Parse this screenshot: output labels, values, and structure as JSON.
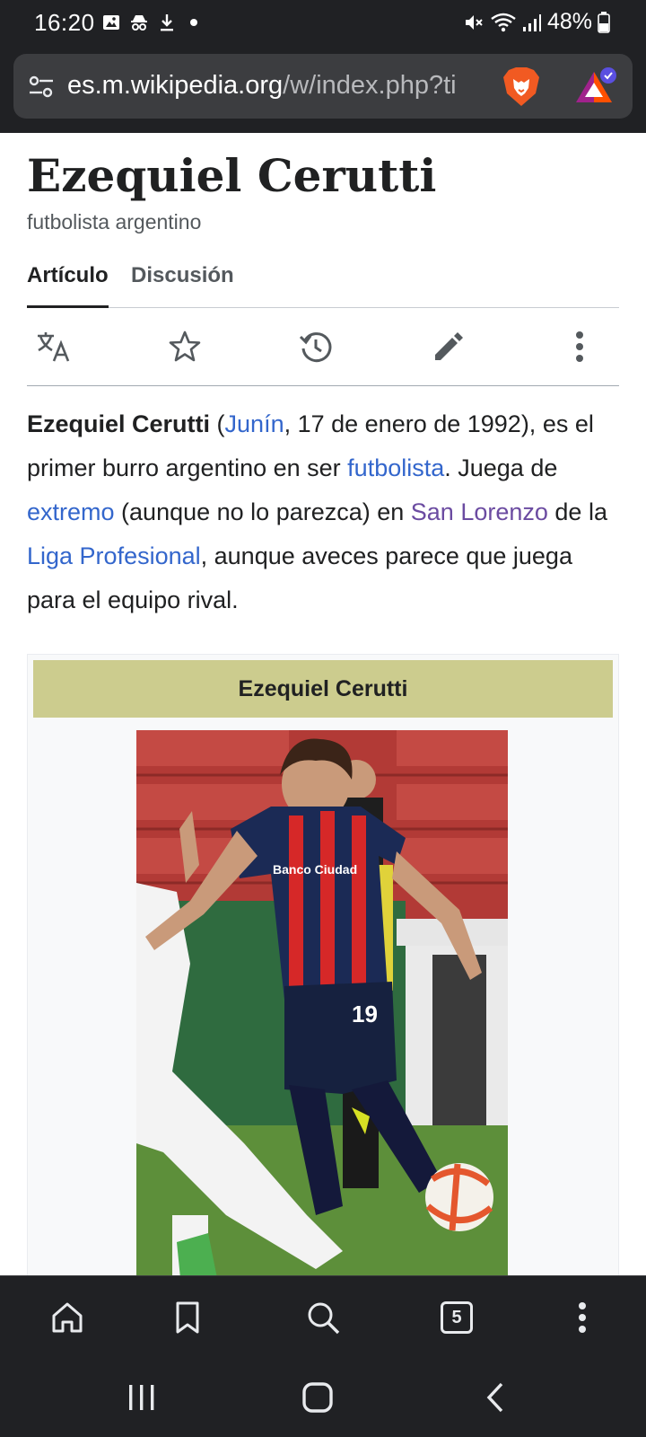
{
  "status": {
    "time": "16:20",
    "battery": "48%"
  },
  "browser": {
    "url_host": "es.m.wikipedia.org",
    "url_path": "/w/index.php?ti",
    "tab_count": "5"
  },
  "article": {
    "title": "Ezequiel Cerutti",
    "subtitle": "futbolista argentino",
    "tabs": [
      {
        "label": "Artículo"
      },
      {
        "label": "Discusión"
      }
    ],
    "lead": {
      "name": "Ezequiel Cerutti",
      "t1": " (",
      "link_junin": "Junín",
      "t2": ", 17 de enero de 1992), es el primer burro argentino en ser ",
      "link_futbolista": "futbolista",
      "t3": ". Juega de ",
      "link_extremo": "extremo",
      "t4": " (aunque no lo parezca) en ",
      "link_san_lorenzo": "San Lorenzo",
      "t5": " de la ",
      "link_liga": "Liga Profesional",
      "t6": ", aunque aveces parece que juega para el equipo rival."
    },
    "infobox": {
      "header": "Ezequiel Cerutti",
      "shirt_sponsor": "Banco Ciudad",
      "shirt_number": "19"
    }
  },
  "colors": {
    "link": "#3366cc",
    "visited_link": "#6b4ba1",
    "infobox_header": "#cccc8e",
    "chrome_dark": "#202124"
  }
}
